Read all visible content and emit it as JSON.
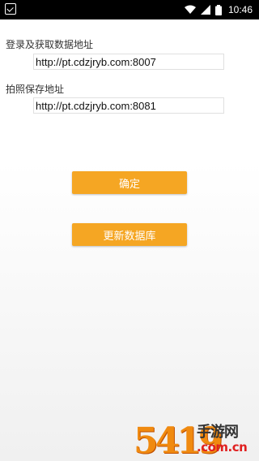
{
  "status_bar": {
    "time": "10:46",
    "icons": [
      "notification-check-icon",
      "wifi-icon",
      "signal-icon",
      "battery-icon"
    ]
  },
  "form": {
    "login_label": "登录及获取数据地址",
    "login_value": "http://pt.cdzjryb.com:8007",
    "photo_label": "拍照保存地址",
    "photo_value": "http://pt.cdzjryb.com:8081"
  },
  "buttons": {
    "confirm_label": "确定",
    "update_db_label": "更新数据库"
  },
  "watermark": {
    "number": "5419",
    "text": "手游网",
    "domain": ".com.cn"
  },
  "colors": {
    "accent": "#f5a623",
    "status_bar": "#000000"
  }
}
